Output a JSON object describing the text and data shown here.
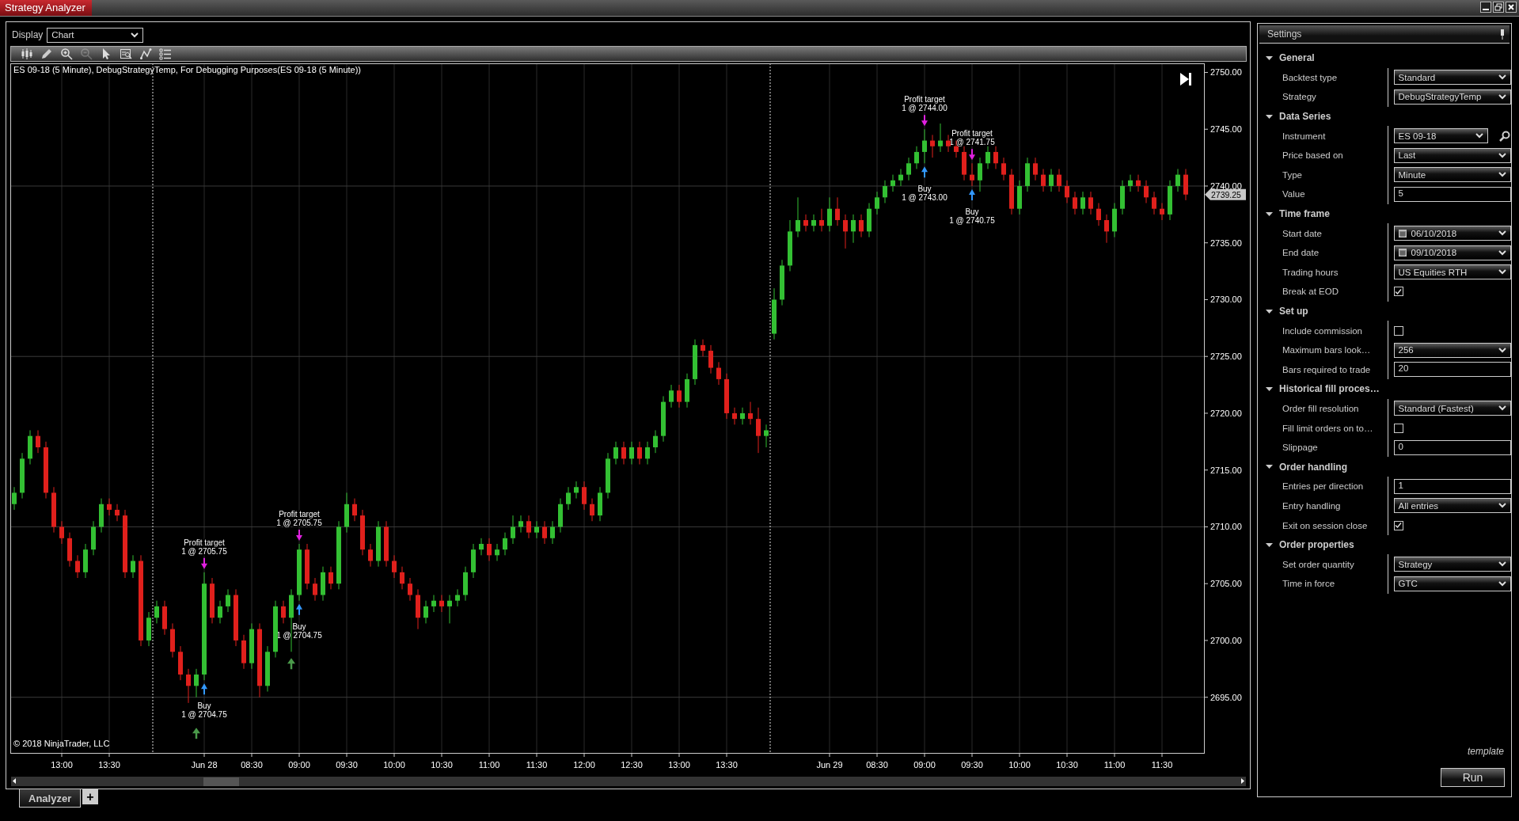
{
  "window": {
    "title": "Strategy Analyzer"
  },
  "display": {
    "label": "Display",
    "value": "Chart"
  },
  "toolbar": [
    {
      "kind": "bars",
      "disabled": false
    },
    {
      "kind": "pencil",
      "disabled": false
    },
    {
      "kind": "zoom_in",
      "disabled": false
    },
    {
      "kind": "zoom_out",
      "disabled": true
    },
    {
      "kind": "pointer",
      "disabled": false
    },
    {
      "kind": "data_box",
      "disabled": false
    },
    {
      "kind": "line",
      "disabled": false
    },
    {
      "kind": "list",
      "disabled": false
    }
  ],
  "chart": {
    "title": "ES 09-18 (5 Minute), DebugStrategyTemp, For Debugging Purposes(ES 09-18 (5 Minute))",
    "copyright": "© 2018 NinjaTrader, LLC",
    "price_marker": "2739.25",
    "chart_data": {
      "type": "candlestick",
      "grid": true,
      "ylim": [
        2690.1,
        2750.8
      ],
      "yticks": [
        {
          "value": 2695,
          "label": "2695.00"
        },
        {
          "value": 2700,
          "label": "2700.00"
        },
        {
          "value": 2705,
          "label": "2705.00"
        },
        {
          "value": 2710,
          "label": "2710.00"
        },
        {
          "value": 2715,
          "label": "2715.00"
        },
        {
          "value": 2720,
          "label": "2720.00"
        },
        {
          "value": 2725,
          "label": "2725.00"
        },
        {
          "value": 2730,
          "label": "2730.00"
        },
        {
          "value": 2735,
          "label": "2735.00"
        },
        {
          "value": 2740,
          "label": "2740.00"
        },
        {
          "value": 2745,
          "label": "2745.00"
        },
        {
          "value": 2750,
          "label": "2750.00"
        }
      ],
      "categories": [
        null,
        null,
        null,
        null,
        null,
        null,
        "13:00",
        null,
        null,
        null,
        null,
        null,
        "13:30",
        null,
        null,
        null,
        null,
        null,
        null,
        null,
        null,
        null,
        null,
        null,
        "Jun 28",
        null,
        null,
        null,
        null,
        null,
        "08:30",
        null,
        null,
        null,
        null,
        null,
        "09:00",
        null,
        null,
        null,
        null,
        null,
        "09:30",
        null,
        null,
        null,
        null,
        null,
        "10:00",
        null,
        null,
        null,
        null,
        null,
        "10:30",
        null,
        null,
        null,
        null,
        null,
        "11:00",
        null,
        null,
        null,
        null,
        null,
        "11:30",
        null,
        null,
        null,
        null,
        null,
        "12:00",
        null,
        null,
        null,
        null,
        null,
        "12:30",
        null,
        null,
        null,
        null,
        null,
        "13:00",
        null,
        null,
        null,
        null,
        null,
        "13:30",
        null,
        null,
        null,
        null,
        null,
        null,
        null,
        null,
        null,
        null,
        null,
        null,
        "Jun 29",
        null,
        null,
        null,
        null,
        null,
        "08:30",
        null,
        null,
        null,
        null,
        null,
        "09:00",
        null,
        null,
        null,
        null,
        null,
        "09:30",
        null,
        null,
        null,
        null,
        null,
        "10:00",
        null,
        null,
        null,
        null,
        null,
        "10:30",
        null,
        null,
        null,
        null,
        null,
        "11:00",
        null,
        null,
        null,
        null,
        null,
        "11:30",
        null,
        null,
        null
      ],
      "ohlc": [
        [
          2712,
          2713.5,
          2711.5,
          2713
        ],
        [
          2713,
          2716.5,
          2712.5,
          2716
        ],
        [
          2716,
          2718.5,
          2715.5,
          2718
        ],
        [
          2718,
          2718.5,
          2716.5,
          2717
        ],
        [
          2717,
          2717.5,
          2712.5,
          2713
        ],
        [
          2713,
          2713.5,
          2709.5,
          2710
        ],
        [
          2710,
          2710.5,
          2708.5,
          2709
        ],
        [
          2709,
          2709.5,
          2706.5,
          2707
        ],
        [
          2707,
          2707.5,
          2705.5,
          2706
        ],
        [
          2706,
          2708.5,
          2705.5,
          2708
        ],
        [
          2708,
          2710.5,
          2707.5,
          2710
        ],
        [
          2710,
          2712.5,
          2709.5,
          2712
        ],
        [
          2712,
          2712.5,
          2711,
          2711.5
        ],
        [
          2711.5,
          2712,
          2710.5,
          2711
        ],
        [
          2711,
          2711.5,
          2705.5,
          2706
        ],
        [
          2706,
          2707.5,
          2705.5,
          2707
        ],
        [
          2707,
          2707.5,
          2699.5,
          2700
        ],
        [
          2700,
          2702.5,
          2699.5,
          2702
        ],
        [
          2702,
          2703.5,
          2701.5,
          2703
        ],
        [
          2703,
          2703.5,
          2700.5,
          2701
        ],
        [
          2701,
          2701.5,
          2698.5,
          2699
        ],
        [
          2699,
          2699.5,
          2696.5,
          2697
        ],
        [
          2697,
          2697.5,
          2694.5,
          2696
        ],
        [
          2696,
          2697.5,
          2695,
          2697
        ],
        [
          2697,
          2706,
          2696.5,
          2705
        ],
        [
          2705,
          2705.5,
          2701.5,
          2702
        ],
        [
          2702,
          2703.5,
          2701.5,
          2703
        ],
        [
          2703,
          2704.5,
          2702.5,
          2704
        ],
        [
          2704,
          2704.5,
          2699.5,
          2700
        ],
        [
          2700,
          2700.5,
          2697.5,
          2698
        ],
        [
          2698,
          2701.5,
          2697.5,
          2701
        ],
        [
          2701,
          2701.5,
          2695,
          2696
        ],
        [
          2696,
          2699.5,
          2695.5,
          2699
        ],
        [
          2699,
          2703.5,
          2698.5,
          2703
        ],
        [
          2703,
          2703.5,
          2701.5,
          2702
        ],
        [
          2702,
          2704.5,
          2699,
          2704
        ],
        [
          2704,
          2708.5,
          2703.5,
          2708
        ],
        [
          2708,
          2708.5,
          2704.5,
          2705
        ],
        [
          2705,
          2705.5,
          2703.5,
          2704
        ],
        [
          2704,
          2706.5,
          2703.5,
          2706
        ],
        [
          2706,
          2706.5,
          2704.5,
          2705
        ],
        [
          2705,
          2710.5,
          2704.5,
          2710
        ],
        [
          2710,
          2713,
          2709.5,
          2712
        ],
        [
          2712,
          2712.5,
          2710.5,
          2711
        ],
        [
          2711,
          2711.5,
          2707.5,
          2708
        ],
        [
          2708,
          2708.5,
          2706.5,
          2707
        ],
        [
          2707,
          2710.5,
          2706.5,
          2710
        ],
        [
          2710,
          2710.5,
          2706.5,
          2707
        ],
        [
          2707,
          2707.5,
          2705.5,
          2706
        ],
        [
          2706,
          2706.5,
          2704.5,
          2705
        ],
        [
          2705,
          2705.5,
          2703.5,
          2704
        ],
        [
          2704,
          2704.5,
          2701,
          2702
        ],
        [
          2702,
          2703.5,
          2701.5,
          2703
        ],
        [
          2703,
          2704,
          2702.5,
          2703.5
        ],
        [
          2703.5,
          2704,
          2702.5,
          2703
        ],
        [
          2703,
          2704,
          2701.5,
          2703.5
        ],
        [
          2703.5,
          2704.5,
          2703,
          2704
        ],
        [
          2704,
          2706.5,
          2703.5,
          2706
        ],
        [
          2706,
          2708.5,
          2705.5,
          2708
        ],
        [
          2708,
          2709,
          2707.5,
          2708.5
        ],
        [
          2708.5,
          2709,
          2707,
          2707.5
        ],
        [
          2707.5,
          2708.5,
          2707,
          2708
        ],
        [
          2708,
          2709.5,
          2707.5,
          2709
        ],
        [
          2709,
          2711,
          2708.5,
          2710
        ],
        [
          2710,
          2711,
          2709.5,
          2710.5
        ],
        [
          2710.5,
          2711,
          2709,
          2709.5
        ],
        [
          2709.5,
          2710.5,
          2709,
          2710
        ],
        [
          2710,
          2710.5,
          2708.5,
          2709
        ],
        [
          2709,
          2710.5,
          2708.5,
          2710
        ],
        [
          2710,
          2712.5,
          2709.5,
          2712
        ],
        [
          2712,
          2713.5,
          2711.5,
          2713
        ],
        [
          2713,
          2714,
          2712.5,
          2713.5
        ],
        [
          2713.5,
          2714,
          2711.5,
          2712
        ],
        [
          2712,
          2712.5,
          2710.5,
          2711
        ],
        [
          2711,
          2713.5,
          2710.5,
          2713
        ],
        [
          2713,
          2716.5,
          2712.5,
          2716
        ],
        [
          2716,
          2717.5,
          2715.5,
          2717
        ],
        [
          2717,
          2717.5,
          2715.5,
          2716
        ],
        [
          2716,
          2717.5,
          2715.5,
          2717
        ],
        [
          2717,
          2717.5,
          2715.5,
          2716
        ],
        [
          2716,
          2717.5,
          2715.5,
          2717
        ],
        [
          2717,
          2718.5,
          2716.5,
          2718
        ],
        [
          2718,
          2721.5,
          2717.5,
          2721
        ],
        [
          2721,
          2722.5,
          2720.5,
          2722
        ],
        [
          2722,
          2722.5,
          2720.5,
          2721
        ],
        [
          2721,
          2723.5,
          2720.5,
          2723
        ],
        [
          2723,
          2726.5,
          2722.5,
          2726
        ],
        [
          2726,
          2726.5,
          2725,
          2725.5
        ],
        [
          2725.5,
          2726,
          2723.5,
          2724
        ],
        [
          2724,
          2724.5,
          2722.5,
          2723
        ],
        [
          2723,
          2723.5,
          2719.5,
          2720
        ],
        [
          2720,
          2720.5,
          2719,
          2719.5
        ],
        [
          2719.5,
          2720.5,
          2719,
          2720
        ],
        [
          2720,
          2721,
          2719,
          2719.5
        ],
        [
          2719.5,
          2720.5,
          2716.5,
          2718
        ],
        [
          2718,
          2719,
          2717,
          2718.5
        ],
        [
          2727,
          2731,
          2726.5,
          2730
        ],
        [
          2730,
          2733.5,
          2729.5,
          2733
        ],
        [
          2733,
          2737,
          2732.5,
          2736
        ],
        [
          2736,
          2739,
          2735.5,
          2737
        ],
        [
          2737,
          2737.5,
          2736,
          2736.5
        ],
        [
          2736.5,
          2737.5,
          2736,
          2737
        ],
        [
          2737,
          2738,
          2736,
          2736.5
        ],
        [
          2736.5,
          2739,
          2736,
          2738
        ],
        [
          2738,
          2739,
          2736.5,
          2737
        ],
        [
          2737,
          2737.5,
          2734.5,
          2736
        ],
        [
          2736,
          2737.5,
          2735,
          2737
        ],
        [
          2737,
          2737.5,
          2735.5,
          2736
        ],
        [
          2736,
          2738.5,
          2735.5,
          2738
        ],
        [
          2738,
          2739.5,
          2737.5,
          2739
        ],
        [
          2739,
          2740.5,
          2738.5,
          2740
        ],
        [
          2740,
          2741,
          2739.5,
          2740.5
        ],
        [
          2740.5,
          2741.5,
          2740,
          2741
        ],
        [
          2741,
          2742.5,
          2740.5,
          2742
        ],
        [
          2742,
          2743.5,
          2741.5,
          2743
        ],
        [
          2743,
          2745,
          2742,
          2744
        ],
        [
          2744,
          2744.5,
          2742.5,
          2743.5
        ],
        [
          2743.5,
          2745.5,
          2743,
          2744
        ],
        [
          2744,
          2744.5,
          2743,
          2743.5
        ],
        [
          2743.5,
          2744,
          2742.5,
          2743
        ],
        [
          2743,
          2743.5,
          2740.5,
          2741
        ],
        [
          2741,
          2742,
          2740,
          2740.5
        ],
        [
          2740.5,
          2742.5,
          2739.5,
          2742
        ],
        [
          2742,
          2743.5,
          2741.5,
          2743
        ],
        [
          2743,
          2743.5,
          2741.5,
          2742
        ],
        [
          2742,
          2742.5,
          2740.5,
          2741
        ],
        [
          2741,
          2741.5,
          2737.5,
          2738
        ],
        [
          2738,
          2740.5,
          2737.5,
          2740
        ],
        [
          2740,
          2742.5,
          2739.5,
          2742
        ],
        [
          2742,
          2742.5,
          2740.5,
          2741
        ],
        [
          2741,
          2741.5,
          2739.5,
          2740
        ],
        [
          2740,
          2741.5,
          2739.5,
          2741
        ],
        [
          2741,
          2741.5,
          2739.5,
          2740
        ],
        [
          2740,
          2740.5,
          2738.5,
          2739
        ],
        [
          2739,
          2739.5,
          2737.5,
          2738
        ],
        [
          2738,
          2739.5,
          2737.5,
          2739
        ],
        [
          2739,
          2739.5,
          2737.5,
          2738
        ],
        [
          2738,
          2738.5,
          2736.5,
          2737
        ],
        [
          2737,
          2737.5,
          2735,
          2736
        ],
        [
          2736,
          2738.5,
          2735.5,
          2738
        ],
        [
          2738,
          2740.5,
          2737.5,
          2740
        ],
        [
          2740,
          2741,
          2739.5,
          2740.5
        ],
        [
          2740.5,
          2741,
          2739.5,
          2740
        ],
        [
          2740,
          2740.5,
          2738.5,
          2739
        ],
        [
          2739,
          2739.5,
          2737.5,
          2738
        ],
        [
          2738,
          2738.5,
          2737,
          2737.5
        ],
        [
          2737.5,
          2740.5,
          2737,
          2740
        ],
        [
          2740,
          2741.5,
          2739.5,
          2741
        ],
        [
          2741,
          2741.5,
          2738.75,
          2739.25
        ]
      ],
      "annotations": [
        {
          "text": "Profit target\n1 @ 2705.75",
          "x": "Jun 28",
          "y": 2706
        },
        {
          "text": "Buy\n1 @ 2704.75",
          "x": "Jun 28",
          "y": 2696.5
        },
        {
          "text": "Profit target\n1 @ 2705.75",
          "x": "09:00",
          "y": 2708.5
        },
        {
          "text": "Buy\n1 @ 2704.75",
          "x": "09:00",
          "y": 2703.5
        },
        "Profit target\n1 @ 2744.00",
        "Buy\n1 @ 2743.00",
        "Profit target\n1 @ 2741.75",
        "Buy\n1 @ 2740.75"
      ]
    }
  },
  "bottom_tabs": [
    {
      "label": "Analyzer",
      "selected": true
    }
  ],
  "add_tab": "+",
  "settings": {
    "title": "Settings",
    "groups": [
      {
        "name": "General",
        "expanded": true,
        "properties": [
          {
            "label": "Backtest type",
            "kind": "dropdown",
            "value": "Standard"
          },
          {
            "label": "Strategy",
            "kind": "dropdown",
            "value": "DebugStrategyTemp"
          }
        ]
      },
      {
        "name": "Data Series",
        "expanded": true,
        "properties": [
          {
            "label": "Instrument",
            "kind": "instrument",
            "value": "ES 09-18"
          },
          {
            "label": "Price based on",
            "kind": "dropdown",
            "value": "Last"
          },
          {
            "label": "Type",
            "kind": "dropdown",
            "value": "Minute"
          },
          {
            "label": "Value",
            "kind": "text",
            "value": "5"
          }
        ]
      },
      {
        "name": "Time frame",
        "expanded": true,
        "properties": [
          {
            "label": "Start date",
            "kind": "date",
            "value": "06/10/2018"
          },
          {
            "label": "End date",
            "kind": "date",
            "value": "09/10/2018"
          },
          {
            "label": "Trading hours",
            "kind": "dropdown",
            "value": "US Equities RTH"
          },
          {
            "label": "Break at EOD",
            "kind": "checkbox",
            "checked": true
          }
        ]
      },
      {
        "name": "Set up",
        "expanded": true,
        "properties": [
          {
            "label": "Include commission",
            "kind": "checkbox",
            "checked": false
          },
          {
            "label": "Maximum bars look…",
            "kind": "dropdown",
            "value": "256"
          },
          {
            "label": "Bars required to trade",
            "kind": "text",
            "value": "20"
          }
        ]
      },
      {
        "name": "Historical fill proces…",
        "expanded": true,
        "properties": [
          {
            "label": "Order fill resolution",
            "kind": "dropdown",
            "value": "Standard (Fastest)"
          },
          {
            "label": "Fill limit orders on to…",
            "kind": "checkbox",
            "checked": false
          },
          {
            "label": "Slippage",
            "kind": "text",
            "value": "0"
          }
        ]
      },
      {
        "name": "Order handling",
        "expanded": true,
        "properties": [
          {
            "label": "Entries per direction",
            "kind": "text",
            "value": "1"
          },
          {
            "label": "Entry handling",
            "kind": "dropdown",
            "value": "All entries"
          },
          {
            "label": "Exit on session close",
            "kind": "checkbox",
            "checked": true
          }
        ]
      },
      {
        "name": "Order properties",
        "expanded": true,
        "properties": [
          {
            "label": "Set order quantity",
            "kind": "dropdown",
            "value": "Strategy"
          },
          {
            "label": "Time in force",
            "kind": "dropdown",
            "value": "GTC"
          }
        ]
      }
    ],
    "template_link": "template",
    "run_button": "Run"
  }
}
